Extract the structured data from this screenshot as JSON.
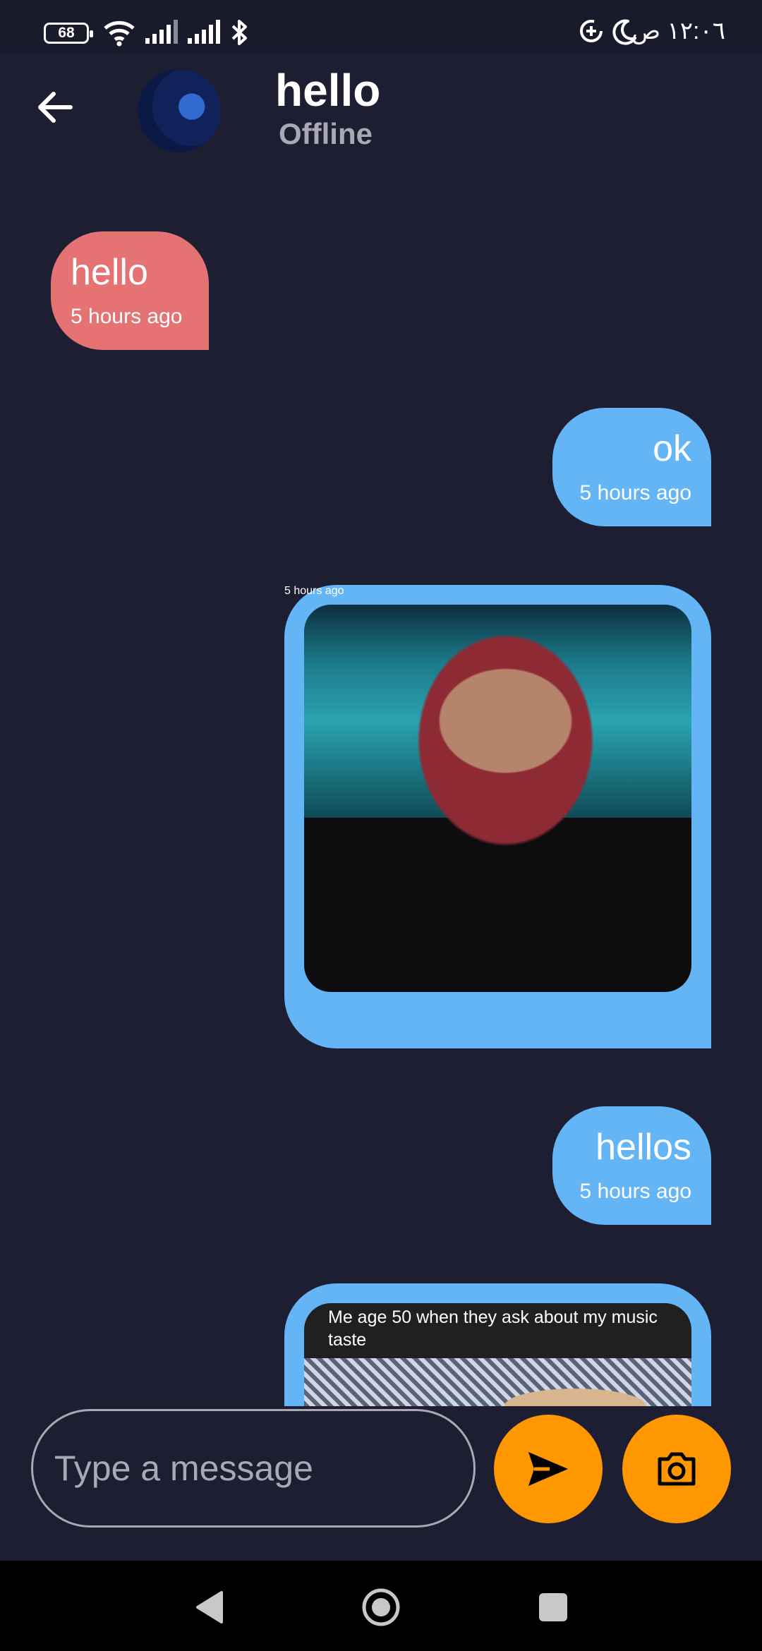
{
  "status_bar": {
    "battery": "68",
    "time": "١٢:٠٦ ص",
    "icons": [
      "wifi-icon",
      "signal-icon",
      "signal-icon",
      "bluetooth-icon",
      "data-saver-icon",
      "moon-icon"
    ]
  },
  "header": {
    "back_icon": "arrow-left-icon",
    "name": "hello",
    "status": "Offline"
  },
  "messages": [
    {
      "type": "text",
      "direction": "received",
      "text": "hello",
      "time": "5 hours ago"
    },
    {
      "type": "text",
      "direction": "sent",
      "text": "ok",
      "time": "5 hours ago"
    },
    {
      "type": "image",
      "direction": "sent",
      "time": "5 hours ago"
    },
    {
      "type": "text",
      "direction": "sent",
      "text": "hellos",
      "time": "5 hours ago"
    },
    {
      "type": "image",
      "direction": "sent",
      "caption": "Me age 50 when they ask about my music taste"
    }
  ],
  "composer": {
    "placeholder": "Type a message",
    "send_icon": "send-icon",
    "camera_icon": "camera-icon"
  },
  "colors": {
    "background": "#1e1e33",
    "received_bubble": "#e57373",
    "sent_bubble": "#64b5f6",
    "accent": "#ff9800"
  },
  "nav": [
    "back-triangle-icon",
    "home-circle-icon",
    "recents-square-icon"
  ]
}
